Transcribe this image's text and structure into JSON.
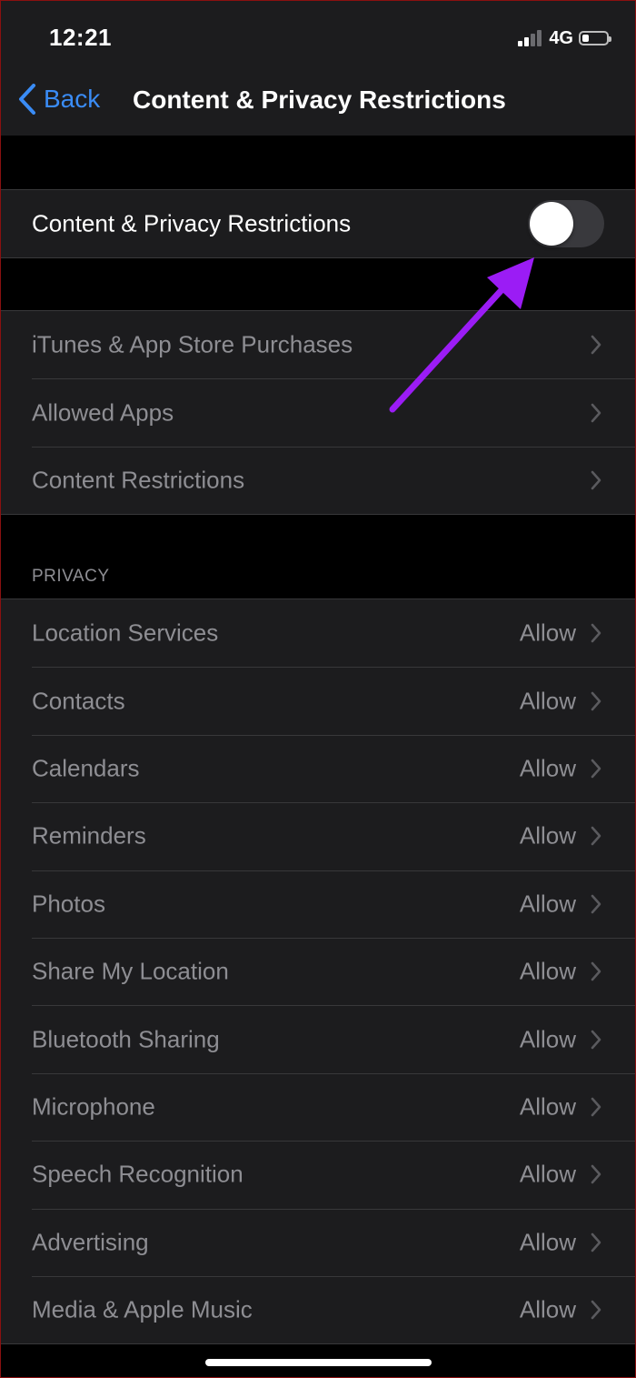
{
  "status_bar": {
    "time": "12:21",
    "network": "4G"
  },
  "nav": {
    "back_label": "Back",
    "title": "Content & Privacy Restrictions"
  },
  "main_toggle": {
    "label": "Content & Privacy Restrictions",
    "on": false
  },
  "store_section": {
    "items": [
      {
        "label": "iTunes & App Store Purchases"
      },
      {
        "label": "Allowed Apps"
      },
      {
        "label": "Content Restrictions"
      }
    ]
  },
  "privacy_section": {
    "header": "PRIVACY",
    "items": [
      {
        "label": "Location Services",
        "value": "Allow"
      },
      {
        "label": "Contacts",
        "value": "Allow"
      },
      {
        "label": "Calendars",
        "value": "Allow"
      },
      {
        "label": "Reminders",
        "value": "Allow"
      },
      {
        "label": "Photos",
        "value": "Allow"
      },
      {
        "label": "Share My Location",
        "value": "Allow"
      },
      {
        "label": "Bluetooth Sharing",
        "value": "Allow"
      },
      {
        "label": "Microphone",
        "value": "Allow"
      },
      {
        "label": "Speech Recognition",
        "value": "Allow"
      },
      {
        "label": "Advertising",
        "value": "Allow"
      },
      {
        "label": "Media & Apple Music",
        "value": "Allow"
      }
    ]
  },
  "colors": {
    "accent": "#3a8cf6",
    "annotation_arrow": "#9b1cf5"
  },
  "icons": [
    "back-chevron-icon",
    "chevron-right-icon",
    "signal-icon",
    "battery-icon",
    "annotation-arrow-icon"
  ]
}
